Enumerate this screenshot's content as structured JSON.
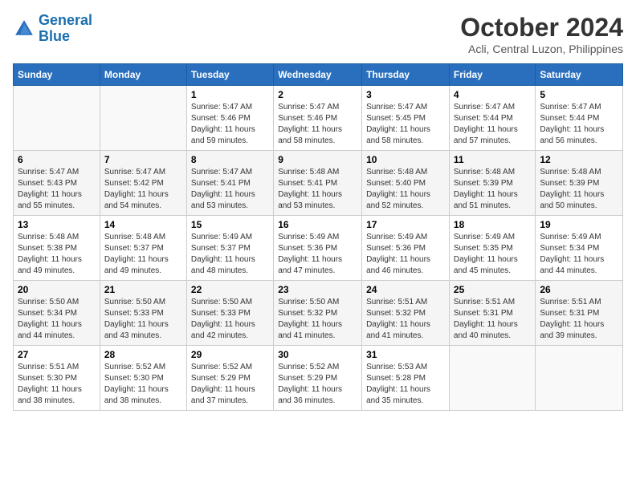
{
  "header": {
    "logo_line1": "General",
    "logo_line2": "Blue",
    "month": "October 2024",
    "location": "Acli, Central Luzon, Philippines"
  },
  "weekdays": [
    "Sunday",
    "Monday",
    "Tuesday",
    "Wednesday",
    "Thursday",
    "Friday",
    "Saturday"
  ],
  "weeks": [
    [
      {
        "day": "",
        "sunrise": "",
        "sunset": "",
        "daylight": ""
      },
      {
        "day": "",
        "sunrise": "",
        "sunset": "",
        "daylight": ""
      },
      {
        "day": "1",
        "sunrise": "Sunrise: 5:47 AM",
        "sunset": "Sunset: 5:46 PM",
        "daylight": "Daylight: 11 hours and 59 minutes."
      },
      {
        "day": "2",
        "sunrise": "Sunrise: 5:47 AM",
        "sunset": "Sunset: 5:46 PM",
        "daylight": "Daylight: 11 hours and 58 minutes."
      },
      {
        "day": "3",
        "sunrise": "Sunrise: 5:47 AM",
        "sunset": "Sunset: 5:45 PM",
        "daylight": "Daylight: 11 hours and 58 minutes."
      },
      {
        "day": "4",
        "sunrise": "Sunrise: 5:47 AM",
        "sunset": "Sunset: 5:44 PM",
        "daylight": "Daylight: 11 hours and 57 minutes."
      },
      {
        "day": "5",
        "sunrise": "Sunrise: 5:47 AM",
        "sunset": "Sunset: 5:44 PM",
        "daylight": "Daylight: 11 hours and 56 minutes."
      }
    ],
    [
      {
        "day": "6",
        "sunrise": "Sunrise: 5:47 AM",
        "sunset": "Sunset: 5:43 PM",
        "daylight": "Daylight: 11 hours and 55 minutes."
      },
      {
        "day": "7",
        "sunrise": "Sunrise: 5:47 AM",
        "sunset": "Sunset: 5:42 PM",
        "daylight": "Daylight: 11 hours and 54 minutes."
      },
      {
        "day": "8",
        "sunrise": "Sunrise: 5:47 AM",
        "sunset": "Sunset: 5:41 PM",
        "daylight": "Daylight: 11 hours and 53 minutes."
      },
      {
        "day": "9",
        "sunrise": "Sunrise: 5:48 AM",
        "sunset": "Sunset: 5:41 PM",
        "daylight": "Daylight: 11 hours and 53 minutes."
      },
      {
        "day": "10",
        "sunrise": "Sunrise: 5:48 AM",
        "sunset": "Sunset: 5:40 PM",
        "daylight": "Daylight: 11 hours and 52 minutes."
      },
      {
        "day": "11",
        "sunrise": "Sunrise: 5:48 AM",
        "sunset": "Sunset: 5:39 PM",
        "daylight": "Daylight: 11 hours and 51 minutes."
      },
      {
        "day": "12",
        "sunrise": "Sunrise: 5:48 AM",
        "sunset": "Sunset: 5:39 PM",
        "daylight": "Daylight: 11 hours and 50 minutes."
      }
    ],
    [
      {
        "day": "13",
        "sunrise": "Sunrise: 5:48 AM",
        "sunset": "Sunset: 5:38 PM",
        "daylight": "Daylight: 11 hours and 49 minutes."
      },
      {
        "day": "14",
        "sunrise": "Sunrise: 5:48 AM",
        "sunset": "Sunset: 5:37 PM",
        "daylight": "Daylight: 11 hours and 49 minutes."
      },
      {
        "day": "15",
        "sunrise": "Sunrise: 5:49 AM",
        "sunset": "Sunset: 5:37 PM",
        "daylight": "Daylight: 11 hours and 48 minutes."
      },
      {
        "day": "16",
        "sunrise": "Sunrise: 5:49 AM",
        "sunset": "Sunset: 5:36 PM",
        "daylight": "Daylight: 11 hours and 47 minutes."
      },
      {
        "day": "17",
        "sunrise": "Sunrise: 5:49 AM",
        "sunset": "Sunset: 5:36 PM",
        "daylight": "Daylight: 11 hours and 46 minutes."
      },
      {
        "day": "18",
        "sunrise": "Sunrise: 5:49 AM",
        "sunset": "Sunset: 5:35 PM",
        "daylight": "Daylight: 11 hours and 45 minutes."
      },
      {
        "day": "19",
        "sunrise": "Sunrise: 5:49 AM",
        "sunset": "Sunset: 5:34 PM",
        "daylight": "Daylight: 11 hours and 44 minutes."
      }
    ],
    [
      {
        "day": "20",
        "sunrise": "Sunrise: 5:50 AM",
        "sunset": "Sunset: 5:34 PM",
        "daylight": "Daylight: 11 hours and 44 minutes."
      },
      {
        "day": "21",
        "sunrise": "Sunrise: 5:50 AM",
        "sunset": "Sunset: 5:33 PM",
        "daylight": "Daylight: 11 hours and 43 minutes."
      },
      {
        "day": "22",
        "sunrise": "Sunrise: 5:50 AM",
        "sunset": "Sunset: 5:33 PM",
        "daylight": "Daylight: 11 hours and 42 minutes."
      },
      {
        "day": "23",
        "sunrise": "Sunrise: 5:50 AM",
        "sunset": "Sunset: 5:32 PM",
        "daylight": "Daylight: 11 hours and 41 minutes."
      },
      {
        "day": "24",
        "sunrise": "Sunrise: 5:51 AM",
        "sunset": "Sunset: 5:32 PM",
        "daylight": "Daylight: 11 hours and 41 minutes."
      },
      {
        "day": "25",
        "sunrise": "Sunrise: 5:51 AM",
        "sunset": "Sunset: 5:31 PM",
        "daylight": "Daylight: 11 hours and 40 minutes."
      },
      {
        "day": "26",
        "sunrise": "Sunrise: 5:51 AM",
        "sunset": "Sunset: 5:31 PM",
        "daylight": "Daylight: 11 hours and 39 minutes."
      }
    ],
    [
      {
        "day": "27",
        "sunrise": "Sunrise: 5:51 AM",
        "sunset": "Sunset: 5:30 PM",
        "daylight": "Daylight: 11 hours and 38 minutes."
      },
      {
        "day": "28",
        "sunrise": "Sunrise: 5:52 AM",
        "sunset": "Sunset: 5:30 PM",
        "daylight": "Daylight: 11 hours and 38 minutes."
      },
      {
        "day": "29",
        "sunrise": "Sunrise: 5:52 AM",
        "sunset": "Sunset: 5:29 PM",
        "daylight": "Daylight: 11 hours and 37 minutes."
      },
      {
        "day": "30",
        "sunrise": "Sunrise: 5:52 AM",
        "sunset": "Sunset: 5:29 PM",
        "daylight": "Daylight: 11 hours and 36 minutes."
      },
      {
        "day": "31",
        "sunrise": "Sunrise: 5:53 AM",
        "sunset": "Sunset: 5:28 PM",
        "daylight": "Daylight: 11 hours and 35 minutes."
      },
      {
        "day": "",
        "sunrise": "",
        "sunset": "",
        "daylight": ""
      },
      {
        "day": "",
        "sunrise": "",
        "sunset": "",
        "daylight": ""
      }
    ]
  ]
}
